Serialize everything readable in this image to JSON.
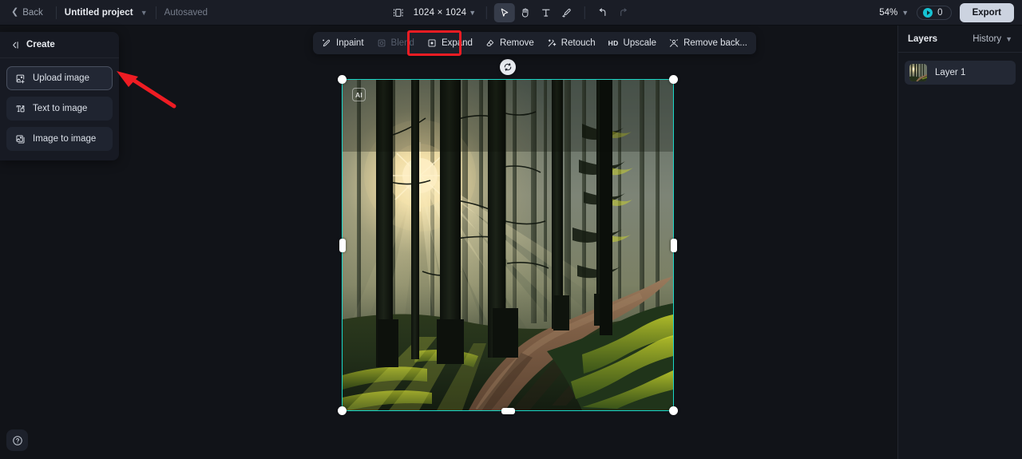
{
  "topbar": {
    "back_label": "Back",
    "project_name": "Untitled project",
    "autosave_label": "Autosaved",
    "canvas_size_label": "1024 × 1024",
    "zoom_label": "54%",
    "credits_count": "0",
    "export_label": "Export",
    "tools": [
      {
        "name": "select-tool",
        "icon": "cursor-icon",
        "active": true
      },
      {
        "name": "hand-tool",
        "icon": "hand-icon",
        "active": false
      },
      {
        "name": "text-tool",
        "icon": "text-icon",
        "active": false
      },
      {
        "name": "brush-tool",
        "icon": "brush-icon",
        "active": false
      },
      {
        "name": "undo-tool",
        "icon": "undo-icon",
        "active": false
      },
      {
        "name": "redo-tool",
        "icon": "redo-icon",
        "active": false
      }
    ]
  },
  "left_panel": {
    "title": "Create",
    "collapse_icon": "collapse-panel-icon",
    "items": [
      {
        "label": "Upload image",
        "icon": "upload-image-icon",
        "selected": true
      },
      {
        "label": "Text to image",
        "icon": "text-to-image-icon",
        "selected": false
      },
      {
        "label": "Image to image",
        "icon": "image-to-image-icon",
        "selected": false
      }
    ]
  },
  "toolbar": {
    "items": [
      {
        "label": "Inpaint",
        "icon": "inpaint-icon",
        "disabled": false,
        "highlighted": false
      },
      {
        "label": "Blend",
        "icon": "blend-icon",
        "disabled": true,
        "highlighted": false
      },
      {
        "label": "Expand",
        "icon": "expand-icon",
        "disabled": false,
        "highlighted": true
      },
      {
        "label": "Remove",
        "icon": "remove-icon",
        "disabled": false,
        "highlighted": false
      },
      {
        "label": "Retouch",
        "icon": "retouch-icon",
        "disabled": false,
        "highlighted": false
      },
      {
        "label": "Upscale",
        "icon": "hd-upscale-icon",
        "disabled": false,
        "highlighted": false
      },
      {
        "label": "Remove back...",
        "icon": "remove-background-icon",
        "disabled": false,
        "highlighted": false
      }
    ]
  },
  "canvas": {
    "refresh_icon": "refresh-icon",
    "ai_badge": "AI",
    "selection_color": "#1AD8C8",
    "image_description": "Sunlit misty forest with tall pine trees, god rays and a winding dirt path"
  },
  "right_panel": {
    "title": "Layers",
    "history_tab": "History",
    "layers": [
      {
        "name": "Layer 1"
      }
    ]
  },
  "help": {
    "icon": "help-circle-icon"
  },
  "annotations": {
    "highlight_color": "#EE1C23",
    "rect_target": "Expand",
    "arrow_target": "Upload image"
  }
}
